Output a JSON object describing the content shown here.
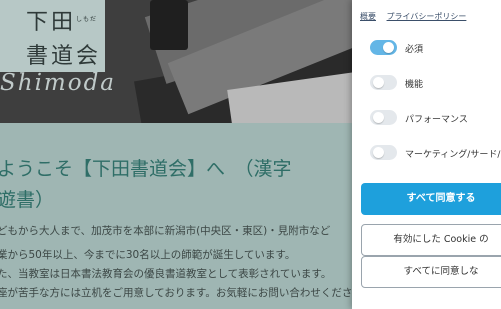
{
  "site": {
    "logo_line1": "下田",
    "logo_reading": "しもだ",
    "logo_line2": "書道会",
    "logo_latin": "Shimoda"
  },
  "main": {
    "welcome_line1": "ようこそ【下田書道会】へ　（漢字",
    "welcome_line2": "遊書）",
    "paragraphs": [
      "どもから大人まで、加茂市を本部に新潟市(中央区・東区)・見附市など",
      "業から50年以上、今までに30名以上の師範が誕生しています。",
      "た、当教室は日本書法教育会の優良書道教室として表彰されています。",
      "座が苦手な方には立机をご用意しております。お気軽にお問い合わせください。"
    ]
  },
  "consent": {
    "links": [
      "概要",
      "プライバシーポリシー"
    ],
    "options": [
      {
        "label": "必須",
        "enabled": true
      },
      {
        "label": "機能",
        "enabled": false
      },
      {
        "label": "パフォーマンス",
        "enabled": false
      },
      {
        "label": "マーケティング/サード/",
        "enabled": false
      }
    ],
    "accept_all": "すべて同意する",
    "accept_enabled": "有効にした Cookie の",
    "reject_all": "すべてに同意しな"
  },
  "colors": {
    "accent": "#1ea0dc",
    "toggle_on": "#64b6e6",
    "heading": "#2f6e67"
  }
}
